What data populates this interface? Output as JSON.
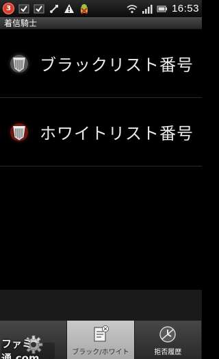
{
  "status_bar": {
    "notification_count": "3",
    "time": "16:53",
    "icons": [
      "notification-count-badge",
      "checkmark-icon",
      "checkmark-icon",
      "usb-icon",
      "warning-icon",
      "android-icon",
      "wifi-icon",
      "signal-icon",
      "battery-icon"
    ]
  },
  "app": {
    "title": "着信騎士"
  },
  "list": {
    "items": [
      {
        "label": "ブラックリスト番号",
        "icon": "blacklist-shield-icon"
      },
      {
        "label": "ホワイトリスト番号",
        "icon": "whitelist-shield-icon"
      }
    ]
  },
  "tabs": [
    {
      "label": "",
      "icon": "settings-gear-icon",
      "selected": false
    },
    {
      "label": "ブラック/ホワイト",
      "icon": "list-edit-icon",
      "selected": true
    },
    {
      "label": "拒否履歴",
      "icon": "reject-history-icon",
      "selected": false
    }
  ],
  "watermark": {
    "text": "ファミ通.com"
  },
  "colors": {
    "accent_red": "#d83a2b",
    "selected_tab": "#c0c0c0"
  }
}
